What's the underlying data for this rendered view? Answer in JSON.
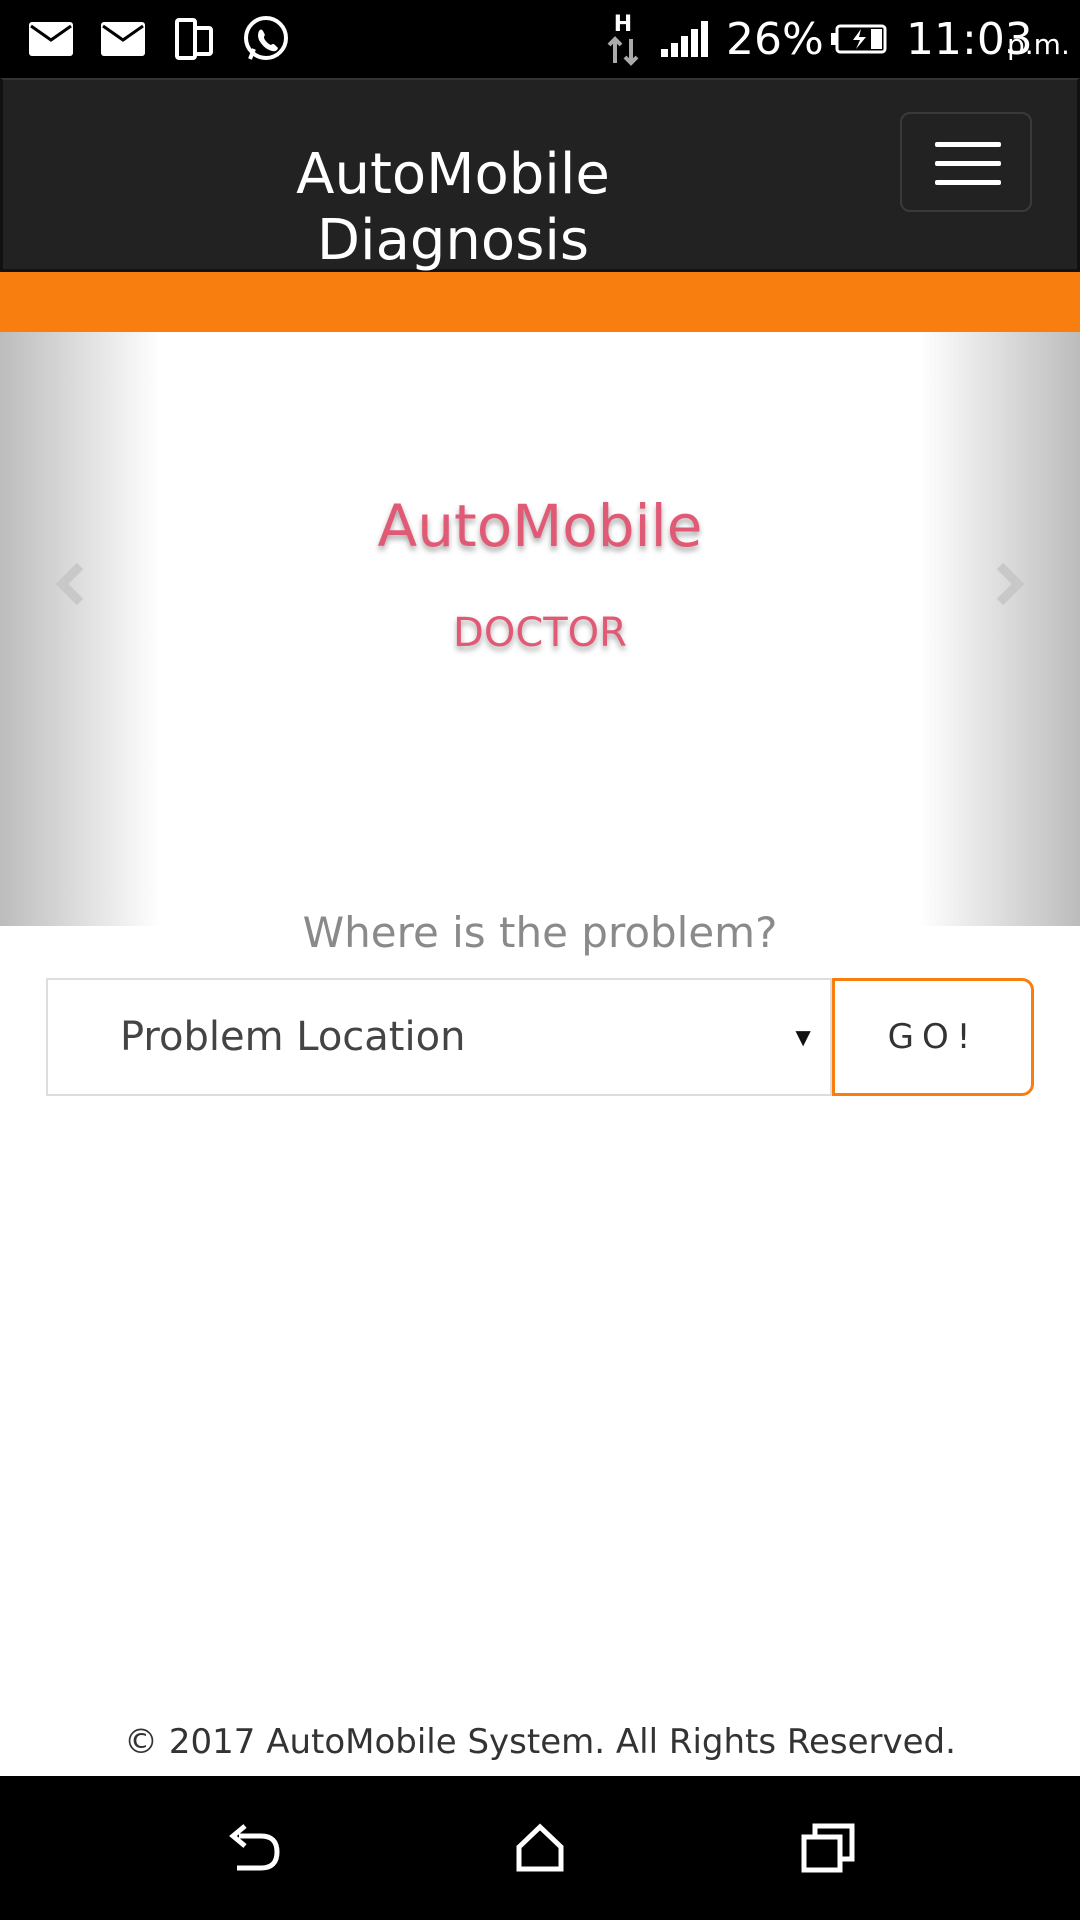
{
  "status_bar": {
    "icons_left": [
      "mail-icon",
      "mail-icon",
      "dual-phone-icon",
      "whatsapp-icon"
    ],
    "network_type": "H",
    "battery_percent": "26%",
    "time": "11:03",
    "ampm": "p.m."
  },
  "navbar": {
    "brand_line1": "AutoMobile",
    "brand_line2": "Diagnosis",
    "menu_icon": "hamburger-menu-icon"
  },
  "colors": {
    "accent": "#f87e10",
    "navbar_bg": "#222222",
    "slide_text": "#e05a75"
  },
  "carousel": {
    "title": "AutoMobile",
    "subtitle": "DOCTOR",
    "prev_icon": "chevron-left-icon",
    "next_icon": "chevron-right-icon"
  },
  "search": {
    "question": "Where is the problem?",
    "select_value": "Problem Location",
    "caret": "▼",
    "button_label": "GO!"
  },
  "footer": {
    "copyright": "© 2017 AutoMobile System. All Rights Reserved."
  },
  "system_nav": {
    "back_icon": "back-icon",
    "home_icon": "home-icon",
    "recents_icon": "recents-icon"
  }
}
